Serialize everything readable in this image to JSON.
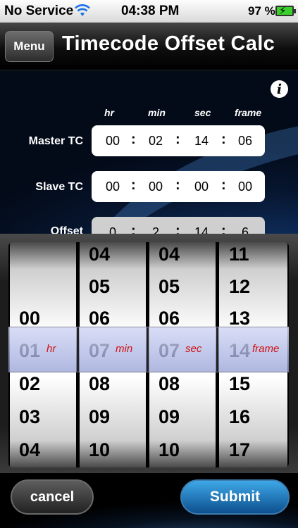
{
  "status_bar": {
    "carrier": "No Service",
    "time": "04:38 PM",
    "battery_percent": "97 %"
  },
  "nav": {
    "menu_label": "Menu",
    "title": "Timecode Offset Calc"
  },
  "columns": [
    "hr",
    "min",
    "sec",
    "frame"
  ],
  "rows": [
    {
      "label": "Master TC",
      "values": [
        "00",
        "02",
        "14",
        "06"
      ]
    },
    {
      "label": "Slave TC",
      "values": [
        "00",
        "00",
        "00",
        "00"
      ]
    },
    {
      "label": "Offset",
      "values": [
        "0",
        "2",
        "14",
        "6"
      ]
    }
  ],
  "picker": {
    "wheels": [
      {
        "unit": "hr",
        "values": [
          "",
          "",
          "00",
          "01",
          "02",
          "03",
          "04"
        ],
        "selected": "01"
      },
      {
        "unit": "min",
        "values": [
          "04",
          "05",
          "06",
          "07",
          "08",
          "09",
          "10"
        ],
        "selected": "07"
      },
      {
        "unit": "sec",
        "values": [
          "04",
          "05",
          "06",
          "07",
          "08",
          "09",
          "10"
        ],
        "selected": "07"
      },
      {
        "unit": "frame",
        "values": [
          "11",
          "12",
          "13",
          "14",
          "15",
          "16",
          "17"
        ],
        "selected": "14"
      }
    ]
  },
  "buttons": {
    "cancel": "cancel",
    "submit": "Submit"
  },
  "colors": {
    "submit_blue": "#1f7fc8",
    "picker_label_red": "#d01010",
    "battery_green": "#3bd12c"
  }
}
